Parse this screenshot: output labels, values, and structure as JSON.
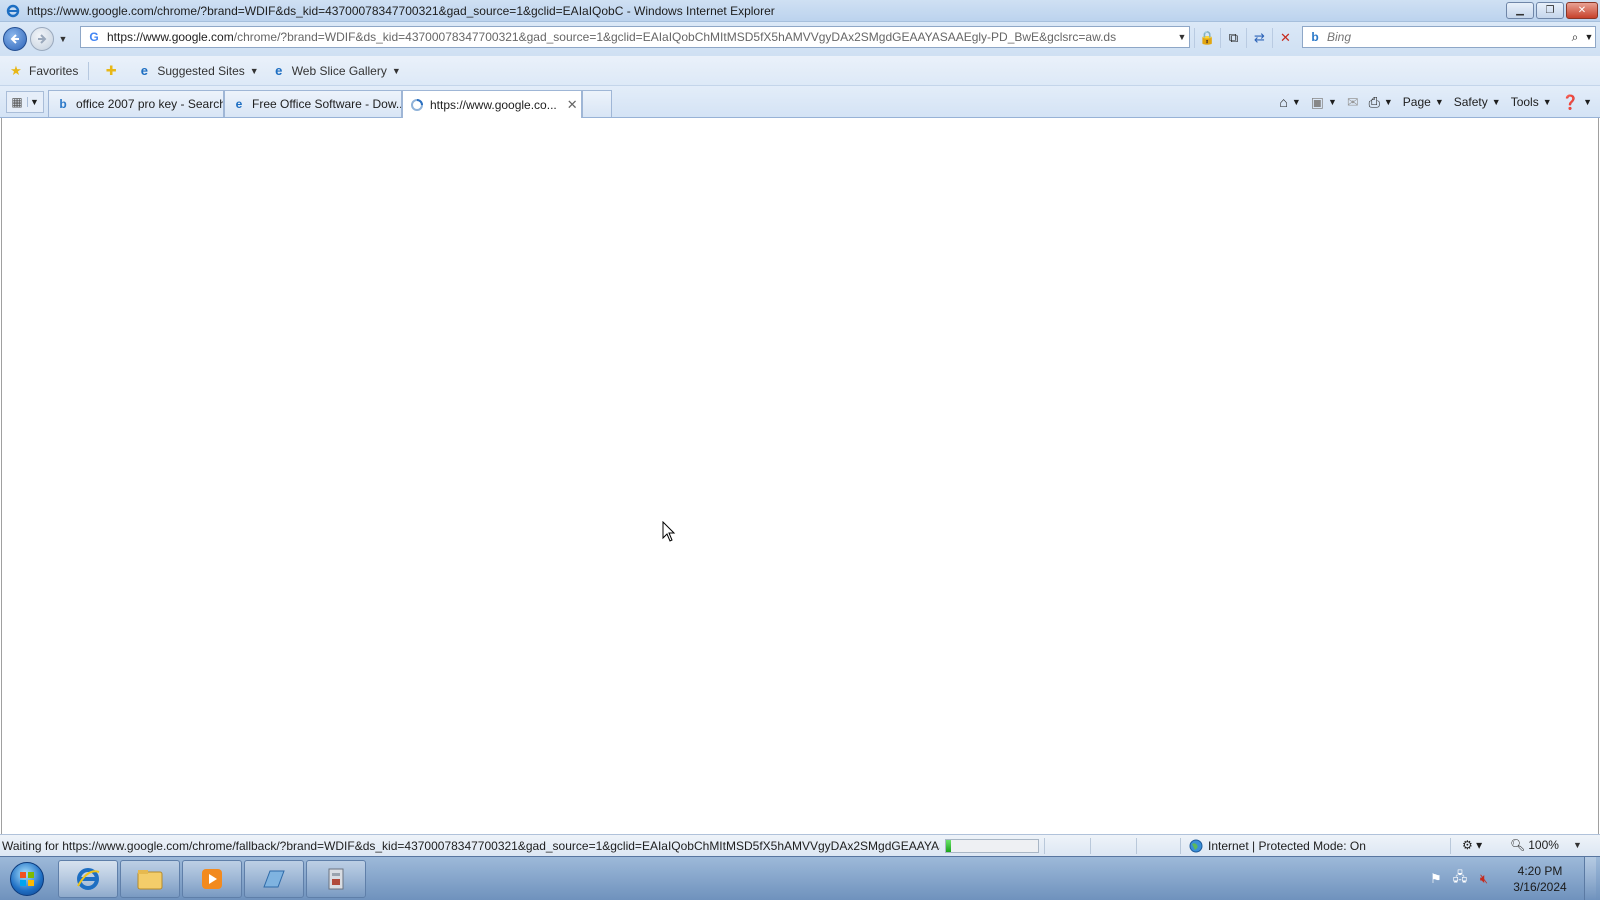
{
  "window": {
    "title": "https://www.google.com/chrome/?brand=WDIF&ds_kid=43700078347700321&gad_source=1&gclid=EAIaIQobC - Windows Internet Explorer"
  },
  "address_bar": {
    "url_host": "https://www.google.com",
    "url_rest": "/chrome/?brand=WDIF&ds_kid=43700078347700321&gad_source=1&gclid=EAIaIQobChMItMSD5fX5hAMVVgyDAx2SMgdGEAAYASAAEgly-PD_BwE&gclsrc=aw.ds"
  },
  "search": {
    "placeholder": "Bing"
  },
  "favorites_bar": {
    "favorites_label": "Favorites",
    "suggested_sites": "Suggested Sites",
    "web_slice_gallery": "Web Slice Gallery"
  },
  "tabs": [
    {
      "label": "office 2007 pro key - Search",
      "icon": "bing-icon"
    },
    {
      "label": "Free Office Software - Dow...",
      "icon": "ie-page-icon"
    },
    {
      "label": "https://www.google.co...",
      "icon": "loading-icon",
      "active": true
    }
  ],
  "command_bar": {
    "page": "Page",
    "safety": "Safety",
    "tools": "Tools"
  },
  "status_bar": {
    "text": "Waiting for https://www.google.com/chrome/fallback/?brand=WDIF&ds_kid=43700078347700321&gad_source=1&gclid=EAIaIQobChMItMSD5fX5hAMVVgyDAx2SMgdGEAAYAS",
    "progress": 0.05,
    "zone": "Internet | Protected Mode: On",
    "zoom": "100%"
  },
  "taskbar": {
    "apps": [
      "internet-explorer",
      "windows-explorer",
      "media-player",
      "app-window",
      "app-installer"
    ],
    "clock_time": "4:20 PM",
    "clock_date": "3/16/2024"
  },
  "colors": {
    "accent": "#2c63b8",
    "taskbar": "#7f9fc6",
    "progress": "#1aa51a"
  }
}
